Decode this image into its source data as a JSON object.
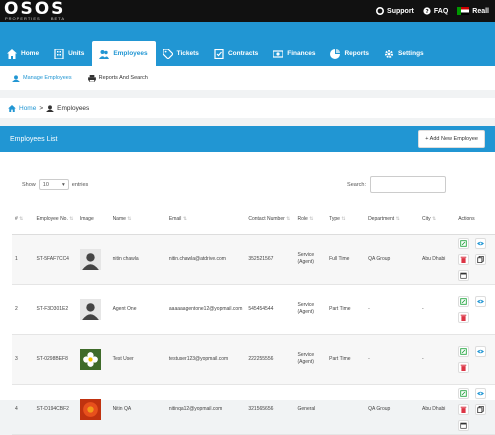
{
  "brand": {
    "logo": "OSOS",
    "sub_left": "PROPERTIES",
    "sub_right": "BETA"
  },
  "topbar": {
    "support": "Support",
    "faq": "FAQ",
    "user": "Reall"
  },
  "nav": [
    {
      "label": "Home",
      "icon": "home-icon"
    },
    {
      "label": "Units",
      "icon": "building-icon"
    },
    {
      "label": "Employees",
      "icon": "people-icon",
      "active": true
    },
    {
      "label": "Tickets",
      "icon": "tag-icon"
    },
    {
      "label": "Contracts",
      "icon": "contract-icon"
    },
    {
      "label": "Finances",
      "icon": "finance-icon"
    },
    {
      "label": "Reports",
      "icon": "report-icon"
    },
    {
      "label": "Settings",
      "icon": "gear-icon"
    }
  ],
  "subnav": {
    "manage": "Manage Employees",
    "reports": "Reports And Search"
  },
  "breadcrumb": {
    "home": "Home",
    "sep": ">",
    "current": "Employees"
  },
  "panel": {
    "title": "Employees List",
    "add_button": "+ Add New Employee"
  },
  "controls": {
    "show": "Show",
    "entries_value": "10",
    "entries": "entries",
    "search": "Search:"
  },
  "table": {
    "headers": [
      "#",
      "Employee No.",
      "Image",
      "Name",
      "Email",
      "Contact Number",
      "Role",
      "Type",
      "Department",
      "City",
      "Actions"
    ],
    "rows": [
      {
        "num": "1",
        "emp_no": "ST-5FAF7CC4",
        "image": "placeholder",
        "name": "nitin chawla",
        "email": "nitin.chawla@atdrive.com",
        "contact": "352521567",
        "role": "Service (Agent)",
        "type": "Full Time",
        "department": "QA Group",
        "city": "Abu Dhabi"
      },
      {
        "num": "2",
        "emp_no": "ST-F3D301E2",
        "image": "placeholder",
        "name": "Agent One",
        "email": "aaaaaagentone12@yopmail.com",
        "contact": "545454544",
        "role": "Service (Agent)",
        "type": "Part Time",
        "department": "-",
        "city": "-"
      },
      {
        "num": "3",
        "emp_no": "ST-0298BEF8",
        "image": "flower-white",
        "name": "Test User",
        "email": "testuser123@yopmail.com",
        "contact": "222255556",
        "role": "Service (Agent)",
        "type": "Part Time",
        "department": "-",
        "city": "-"
      },
      {
        "num": "4",
        "emp_no": "ST-D194CBF2",
        "image": "flower-red",
        "name": "Nitin QA",
        "email": "nitinqa12@yopmail.com",
        "contact": "321565656",
        "role": "General",
        "type": "",
        "department": "QA Group",
        "city": "Abu Dhabi"
      }
    ]
  },
  "colors": {
    "accent": "#2196d3",
    "topbar": "#111111",
    "edit": "#28a745",
    "delete": "#dc3545"
  }
}
